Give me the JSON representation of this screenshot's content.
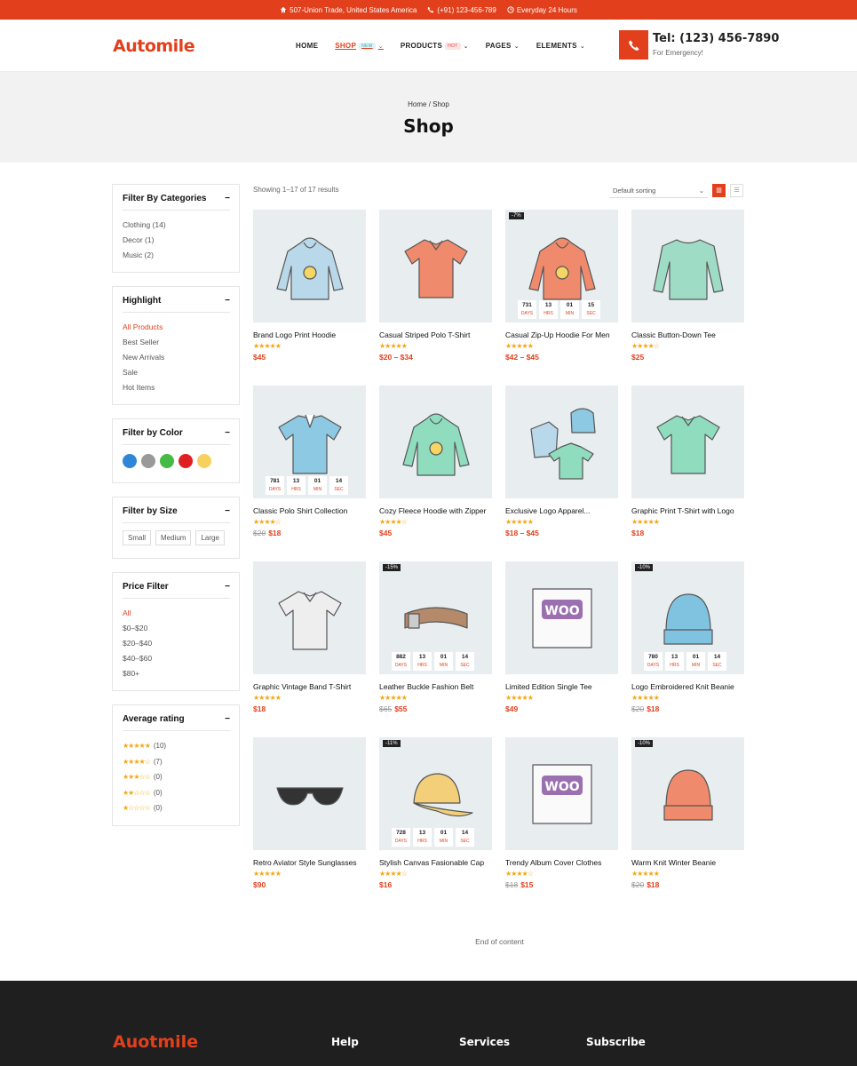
{
  "topbar": {
    "address": "507-Union Trade, United States America",
    "phone": "(+91) 123-456-789",
    "hours": "Everyday 24 Hours"
  },
  "header": {
    "logo_part1": "Auto",
    "logo_part2": "mile",
    "nav": [
      {
        "label": "HOME",
        "badge": "",
        "dropdown": false
      },
      {
        "label": "SHOP",
        "badge": "NEW",
        "dropdown": true
      },
      {
        "label": "PRODUCTS",
        "badge": "HOT",
        "dropdown": true
      },
      {
        "label": "PAGES",
        "badge": "",
        "dropdown": true
      },
      {
        "label": "ELEMENTS",
        "badge": "",
        "dropdown": true
      }
    ],
    "tel": "Tel: (123) 456-7890",
    "tel_sub": "For Emergency!"
  },
  "banner": {
    "breadcrumb": "Home / Shop",
    "title": "Shop"
  },
  "sidebar": {
    "categories": {
      "title": "Filter By Categories",
      "items": [
        "Clothing (14)",
        "Decor (1)",
        "Music (2)"
      ]
    },
    "highlight": {
      "title": "Highlight",
      "items": [
        "All Products",
        "Best Seller",
        "New Arrivals",
        "Sale",
        "Hot Items"
      ]
    },
    "color": {
      "title": "Filter by Color",
      "swatches": [
        "#2f86d6",
        "#999999",
        "#44bb44",
        "#e02020",
        "#f7d05e"
      ]
    },
    "size": {
      "title": "Filter by Size",
      "items": [
        "Small",
        "Medium",
        "Large"
      ]
    },
    "price": {
      "title": "Price Filter",
      "items": [
        "All",
        "$0–$20",
        "$20–$40",
        "$40–$60",
        "$80+"
      ]
    },
    "rating": {
      "title": "Average rating",
      "items": [
        {
          "stars": 5,
          "count": "(10)"
        },
        {
          "stars": 4,
          "count": "(7)"
        },
        {
          "stars": 3,
          "count": "(0)"
        },
        {
          "stars": 2,
          "count": "(0)"
        },
        {
          "stars": 1,
          "count": "(0)"
        }
      ]
    }
  },
  "toolbar": {
    "results": "Showing 1–17 of 17 results",
    "sort": "Default sorting"
  },
  "countdown_labels": [
    "DAYS",
    "HRS",
    "MIN",
    "SEC"
  ],
  "products": [
    {
      "name": "Brand Logo Print Hoodie",
      "stars": 5,
      "old": "",
      "price": "$45",
      "discount": "",
      "countdown": null,
      "icon": "hoodie",
      "color": "#b9d8ea"
    },
    {
      "name": "Casual Striped Polo T-Shirt",
      "stars": 4.5,
      "old": "",
      "price": "$20 – $34",
      "discount": "",
      "countdown": null,
      "icon": "tshirt",
      "color": "#f08a6c"
    },
    {
      "name": "Casual Zip-Up Hoodie For Men",
      "stars": 4.5,
      "old": "",
      "price": "$42 – $45",
      "discount": "-7%",
      "countdown": [
        "731",
        "13",
        "01",
        "15"
      ],
      "icon": "hoodie",
      "color": "#f08a6c"
    },
    {
      "name": "Classic Button-Down Tee",
      "stars": 4,
      "old": "",
      "price": "$25",
      "discount": "",
      "countdown": null,
      "icon": "longsleeve",
      "color": "#9fdcc6"
    },
    {
      "name": "Classic Polo Shirt Collection",
      "stars": 4,
      "old": "$20",
      "price": "$18",
      "discount": "",
      "countdown": [
        "781",
        "13",
        "01",
        "14"
      ],
      "icon": "polo",
      "color": "#8ec9e3"
    },
    {
      "name": "Cozy Fleece Hoodie with Zipper",
      "stars": 4,
      "old": "",
      "price": "$45",
      "discount": "",
      "countdown": null,
      "icon": "hoodie",
      "color": "#8fdcbf"
    },
    {
      "name": "Exclusive Logo Apparel...",
      "stars": 5,
      "old": "",
      "price": "$18 – $45",
      "discount": "",
      "countdown": null,
      "icon": "bundle",
      "color": "#8ec9e3"
    },
    {
      "name": "Graphic Print T-Shirt with Logo",
      "stars": 4.5,
      "old": "",
      "price": "$18",
      "discount": "",
      "countdown": null,
      "icon": "tshirt",
      "color": "#8fdcbf"
    },
    {
      "name": "Graphic Vintage Band T-Shirt",
      "stars": 5,
      "old": "",
      "price": "$18",
      "discount": "",
      "countdown": null,
      "icon": "tshirt",
      "color": "#eeeeee"
    },
    {
      "name": "Leather Buckle Fashion Belt",
      "stars": 5,
      "old": "$65",
      "price": "$55",
      "discount": "-15%",
      "countdown": [
        "882",
        "13",
        "01",
        "14"
      ],
      "icon": "belt",
      "color": "#b48a6a"
    },
    {
      "name": "Limited Edition Single Tee",
      "stars": 5,
      "old": "",
      "price": "$49",
      "discount": "",
      "countdown": null,
      "icon": "woo",
      "color": "#9b6fb0"
    },
    {
      "name": "Logo Embroidered Knit Beanie",
      "stars": 5,
      "old": "$20",
      "price": "$18",
      "discount": "-10%",
      "countdown": [
        "780",
        "13",
        "01",
        "14"
      ],
      "icon": "beanie",
      "color": "#7fc3e0"
    },
    {
      "name": "Retro Aviator Style Sunglasses",
      "stars": 5,
      "old": "",
      "price": "$90",
      "discount": "",
      "countdown": null,
      "icon": "glasses",
      "color": "#333333"
    },
    {
      "name": "Stylish Canvas Fasionable Cap",
      "stars": 4,
      "old": "",
      "price": "$16",
      "discount": "-11%",
      "countdown": [
        "728",
        "13",
        "01",
        "14"
      ],
      "icon": "cap",
      "color": "#f4cf7a"
    },
    {
      "name": "Trendy Album Cover Clothes",
      "stars": 4,
      "old": "$18",
      "price": "$15",
      "discount": "",
      "countdown": null,
      "icon": "woo",
      "color": "#9b6fb0"
    },
    {
      "name": "Warm Knit Winter Beanie",
      "stars": 5,
      "old": "$20",
      "price": "$18",
      "discount": "-10%",
      "countdown": null,
      "icon": "beanie",
      "color": "#f08a6c"
    }
  ],
  "end_text": "End of content",
  "footer": {
    "logo": "Auotmile",
    "cols": [
      "Help",
      "Services",
      "Subscribe"
    ]
  },
  "colors": {
    "accent": "#e2401c",
    "footer_bg": "#1f1f1f",
    "star": "#f3a712"
  }
}
